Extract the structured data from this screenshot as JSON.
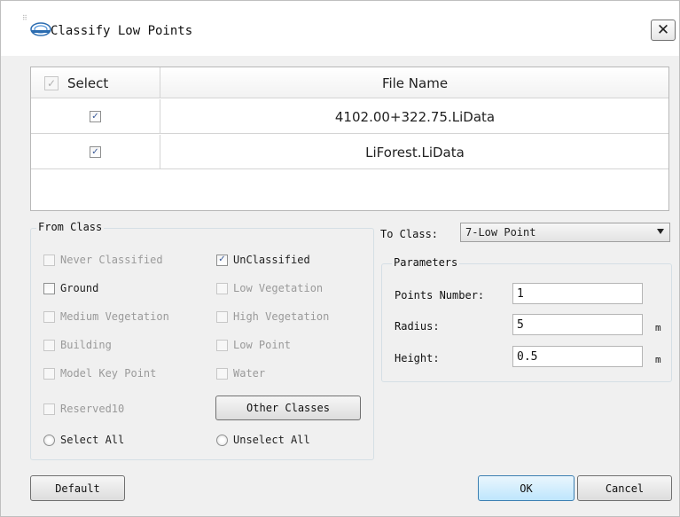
{
  "window": {
    "title": "Classify Low Points",
    "close_label": "✕",
    "logo_alt": "LiDAR360"
  },
  "file_table": {
    "header_select": "Select",
    "header_file": "File Name",
    "rows": [
      {
        "checked": true,
        "file_name": "4102.00+322.75.LiData"
      },
      {
        "checked": true,
        "file_name": "LiForest.LiData"
      }
    ]
  },
  "from_class": {
    "title": "From Class",
    "options": [
      {
        "label": "Never Classified",
        "checked": false,
        "enabled": false
      },
      {
        "label": "UnClassified",
        "checked": true,
        "enabled": true
      },
      {
        "label": "Ground",
        "checked": false,
        "enabled": true
      },
      {
        "label": "Low Vegetation",
        "checked": false,
        "enabled": false
      },
      {
        "label": "Medium Vegetation",
        "checked": false,
        "enabled": false
      },
      {
        "label": "High Vegetation",
        "checked": false,
        "enabled": false
      },
      {
        "label": "Building",
        "checked": false,
        "enabled": false
      },
      {
        "label": "Low Point",
        "checked": false,
        "enabled": false
      },
      {
        "label": "Model Key Point",
        "checked": false,
        "enabled": false
      },
      {
        "label": "Water",
        "checked": false,
        "enabled": false
      },
      {
        "label": "Reserved10",
        "checked": false,
        "enabled": false
      }
    ],
    "other_classes_button": "Other Classes",
    "select_all": "Select All",
    "unselect_all": "Unselect All"
  },
  "to_class": {
    "label": "To Class:",
    "selected": "7-Low Point"
  },
  "parameters": {
    "title": "Parameters",
    "points_number_label": "Points Number:",
    "points_number_value": "1",
    "radius_label": "Radius:",
    "radius_value": "5",
    "radius_unit": "m",
    "height_label": "Height:",
    "height_value": "0.5",
    "height_unit": "m"
  },
  "buttons": {
    "default": "Default",
    "ok": "OK",
    "cancel": "Cancel"
  },
  "icons": {
    "check_mark": "✓",
    "close": "close-icon",
    "logo": "app-logo-icon"
  },
  "colors": {
    "accent_button": "#bee6fd",
    "checkbox_check": "#3a5a98"
  }
}
